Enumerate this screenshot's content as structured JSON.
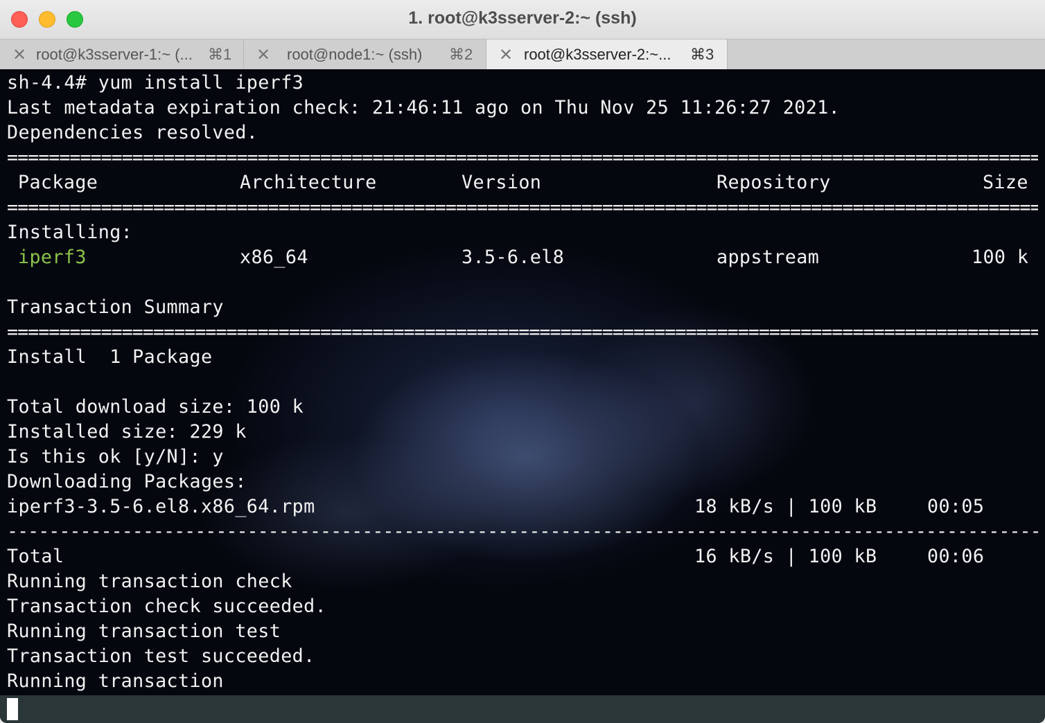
{
  "window": {
    "title": "1. root@k3sserver-2:~ (ssh)"
  },
  "tabs": [
    {
      "label": "root@k3sserver-1:~ (...",
      "shortcut": "⌘1",
      "active": false
    },
    {
      "label": "root@node1:~ (ssh)",
      "shortcut": "⌘2",
      "active": false
    },
    {
      "label": "root@k3sserver-2:~...",
      "shortcut": "⌘3",
      "active": true
    }
  ],
  "terminal": {
    "prompt_line": "sh-4.4# yum install iperf3",
    "metadata_line": "Last metadata expiration check: 21:46:11 ago on Thu Nov 25 11:26:27 2021.",
    "deps_line": "Dependencies resolved.",
    "rule_double": "==========================================================================================================",
    "rule_single": "----------------------------------------------------------------------------------------------------------",
    "table_headers": {
      "package": "Package",
      "architecture": "Architecture",
      "version": "Version",
      "repository": "Repository",
      "size": "Size"
    },
    "installing_label": "Installing:",
    "package_row": {
      "package": "iperf3",
      "architecture": "x86_64",
      "version": "3.5-6.el8",
      "repository": "appstream",
      "size": "100 k"
    },
    "transaction_summary": "Transaction Summary",
    "install_line": "Install  1 Package",
    "total_download": "Total download size: 100 k",
    "installed_size": "Installed size: 229 k",
    "confirm_prompt": "Is this ok [y/N]: y",
    "downloading": "Downloading Packages:",
    "download_row": {
      "file": "iperf3-3.5-6.el8.x86_64.rpm",
      "rate": "18 kB/s | 100 kB",
      "time": "00:05"
    },
    "total_row": {
      "label": "Total",
      "rate": "16 kB/s | 100 kB",
      "time": "00:06"
    },
    "tail_lines": [
      "Running transaction check",
      "Transaction check succeeded.",
      "Running transaction test",
      "Transaction test succeeded.",
      "Running transaction"
    ]
  },
  "colors": {
    "package_name": "#8bc34a",
    "terminal_text": "#f2f2f2",
    "statusbar": "#2a3638"
  }
}
